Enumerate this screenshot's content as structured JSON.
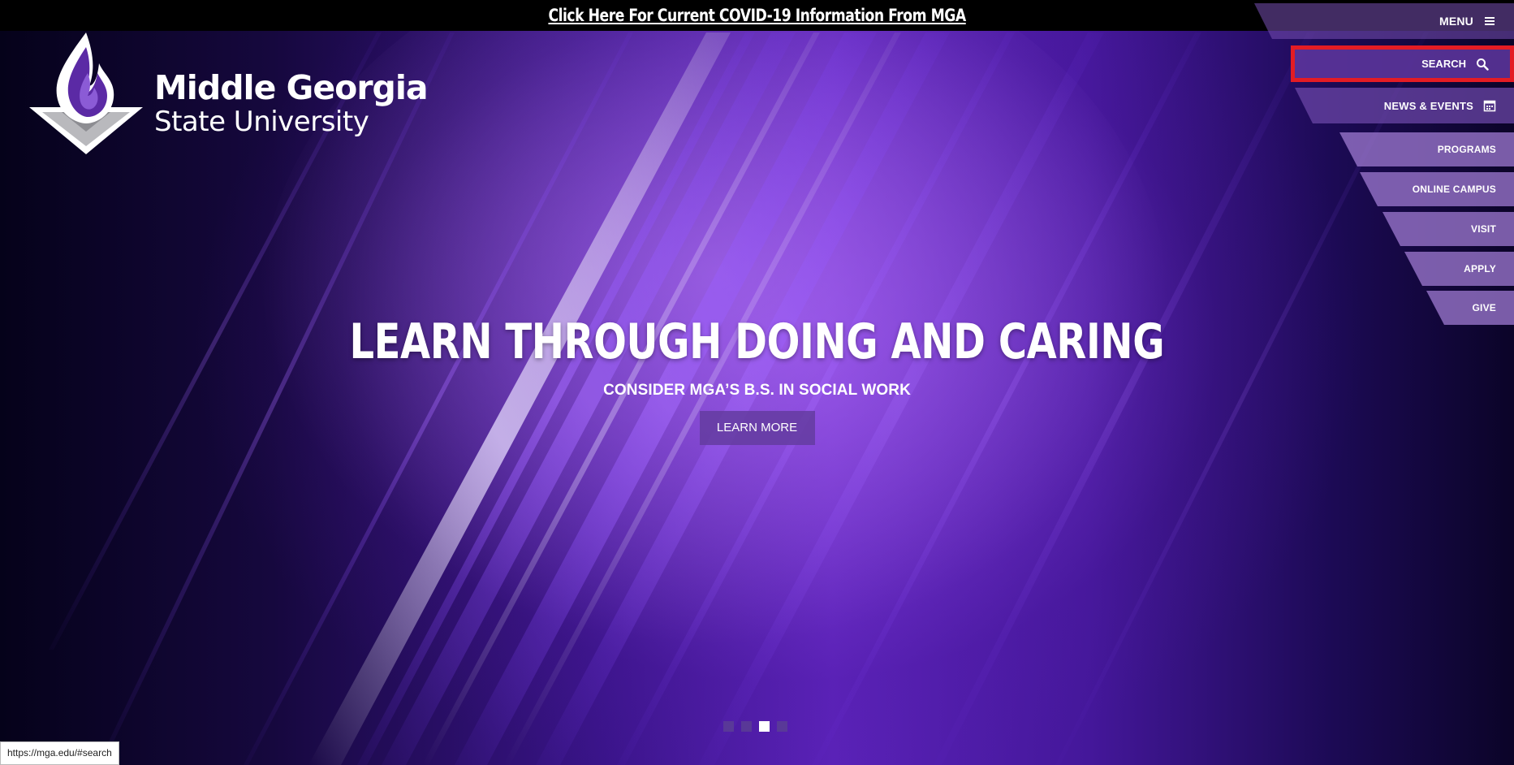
{
  "banner": {
    "covid_link": "Click Here For Current COVID-19 Information From MGA"
  },
  "logo": {
    "line1": "Middle Georgia",
    "line2": "State University"
  },
  "nav": {
    "menu": "MENU",
    "search": "SEARCH",
    "news_events": "NEWS & EVENTS",
    "programs": "PROGRAMS",
    "online_campus": "ONLINE CAMPUS",
    "visit": "VISIT",
    "apply": "APPLY",
    "give": "GIVE"
  },
  "icons": {
    "menu": "hamburger-icon",
    "search": "magnifier-icon",
    "news_events": "calendar-icon"
  },
  "hero": {
    "headline": "LEARN THROUGH DOING AND CARING",
    "subheadline": "CONSIDER MGA’S B.S. IN SOCIAL WORK",
    "cta": "LEARN MORE"
  },
  "carousel": {
    "slide_count": 4,
    "active_index": 2
  },
  "status_bar": {
    "url": "https://mga.edu/#search"
  },
  "colors": {
    "banner_bg": "#000000",
    "accent_purple": "#5a22b8",
    "highlight_red": "#e41c24"
  }
}
